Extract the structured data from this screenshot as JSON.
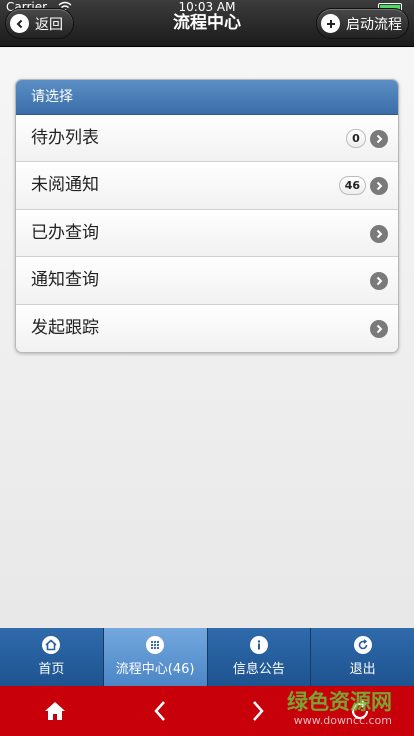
{
  "status_bar": {
    "carrier": "Carrier",
    "time": "10:03 AM"
  },
  "header": {
    "back_label": "返回",
    "title": "流程中心",
    "start_label": "启动流程"
  },
  "list": {
    "header": "请选择",
    "items": [
      {
        "label": "待办列表",
        "count": "0"
      },
      {
        "label": "未阅通知",
        "count": "46"
      },
      {
        "label": "已办查询"
      },
      {
        "label": "通知查询"
      },
      {
        "label": "发起跟踪"
      }
    ]
  },
  "tabbar": {
    "tabs": [
      {
        "label": "首页",
        "icon": "home-icon"
      },
      {
        "label": "流程中心(46)",
        "icon": "grid-icon",
        "active": true
      },
      {
        "label": "信息公告",
        "icon": "info-icon"
      },
      {
        "label": "退出",
        "icon": "logout-icon"
      }
    ]
  },
  "browser_bar": {
    "buttons": [
      "home-icon",
      "back-arrow-icon",
      "forward-arrow-icon",
      "refresh-icon"
    ]
  },
  "watermark": {
    "logo": "绿色资源网",
    "url": "www.downcc.com"
  },
  "colors": {
    "header": "#1b1b1b",
    "list_header": "#3b6ea8",
    "tabbar": "#2f6aab",
    "tab_active": "#5a92cf",
    "browser_bar": "#c8000a"
  }
}
